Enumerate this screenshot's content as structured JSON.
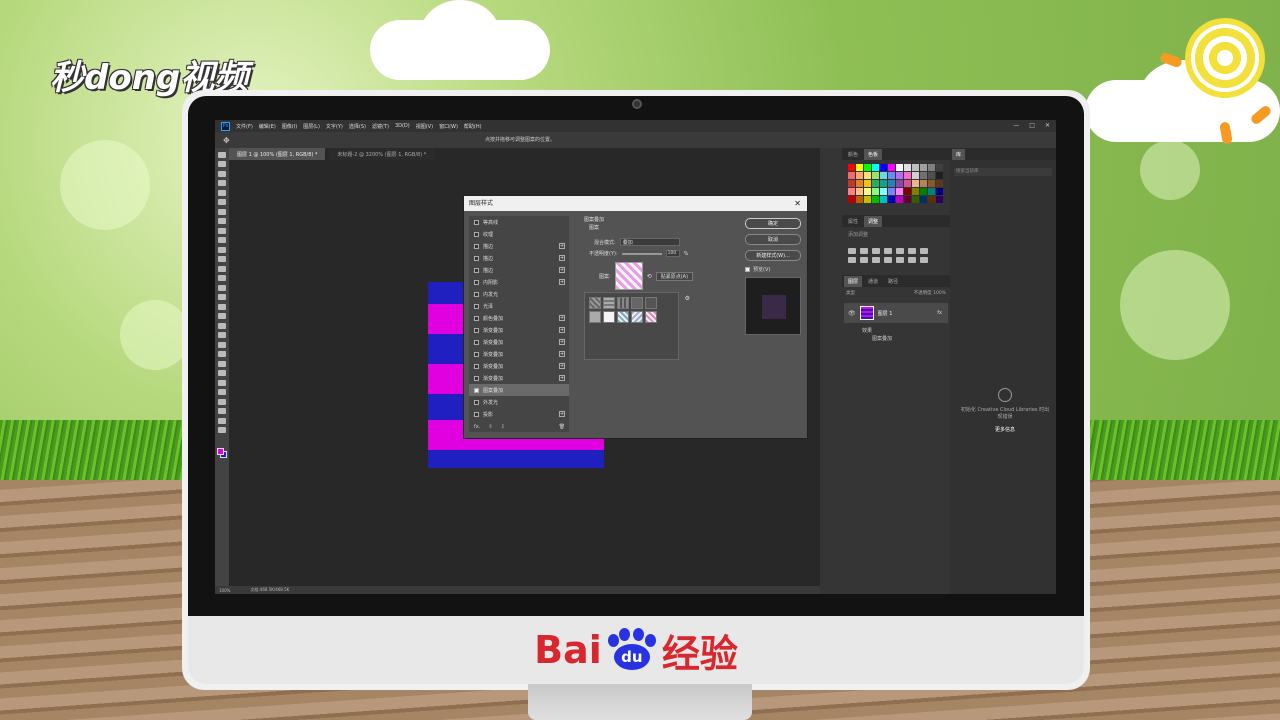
{
  "branding": {
    "top_logo": "秒dong视频",
    "bottom_logo_text_left": "Bai",
    "bottom_logo_paw": "du",
    "bottom_logo_text_right": "经验"
  },
  "app": {
    "logo": "Ps",
    "menu": [
      "文件(F)",
      "编辑(E)",
      "图像(I)",
      "图层(L)",
      "文字(Y)",
      "选择(S)",
      "滤镜(T)",
      "3D(D)",
      "视图(V)",
      "窗口(W)",
      "帮助(H)"
    ],
    "window_controls": [
      "—",
      "□",
      "✕"
    ],
    "options_hint": "点按并拖移可调整图案的位置。",
    "doc_tabs": [
      "图层 1 @ 100% (图层 1, RGB/8) *",
      "未标题-2 @ 3200% (图层 1, RGB/8) *"
    ],
    "status_zoom": "100%",
    "status_doc": "文档:468.5K/468.5K"
  },
  "colors": {
    "magenta": "#e000e0",
    "blue": "#2020c0",
    "ui_dark": "#282828",
    "ui_panel": "#353535"
  },
  "dialog": {
    "title": "图层样式",
    "close": "✕",
    "styles": [
      {
        "label": "等高线",
        "checked": false,
        "plus": false
      },
      {
        "label": "纹理",
        "checked": false,
        "plus": false
      },
      {
        "label": "描边",
        "checked": false,
        "plus": true
      },
      {
        "label": "描边",
        "checked": false,
        "plus": true
      },
      {
        "label": "描边",
        "checked": false,
        "plus": true
      },
      {
        "label": "内阴影",
        "checked": false,
        "plus": true
      },
      {
        "label": "内发光",
        "checked": false,
        "plus": false
      },
      {
        "label": "光泽",
        "checked": false,
        "plus": false
      },
      {
        "label": "颜色叠加",
        "checked": false,
        "plus": true
      },
      {
        "label": "渐变叠加",
        "checked": false,
        "plus": true
      },
      {
        "label": "渐变叠加",
        "checked": false,
        "plus": true
      },
      {
        "label": "渐变叠加",
        "checked": false,
        "plus": true
      },
      {
        "label": "渐变叠加",
        "checked": false,
        "plus": true
      },
      {
        "label": "渐变叠加",
        "checked": false,
        "plus": true
      },
      {
        "label": "图案叠加",
        "checked": true,
        "plus": false,
        "active": true
      },
      {
        "label": "外发光",
        "checked": false,
        "plus": false
      },
      {
        "label": "投影",
        "checked": false,
        "plus": true
      }
    ],
    "list_footer": [
      "fx.",
      "⇧",
      "⇩",
      "🗑"
    ],
    "section_title": "图案叠加",
    "subsection": "图案",
    "blend_label": "混合模式:",
    "blend_value": "叠加",
    "opacity_label": "不透明度(Y):",
    "opacity_value": "100",
    "opacity_unit": "%",
    "pattern_label": "图案:",
    "snap_button": "贴紧原点(A)",
    "buttons": {
      "ok": "确定",
      "cancel": "取消",
      "new_style": "新建样式(W)...",
      "preview_label": "预览(V)"
    }
  },
  "panels": {
    "swatch_tabs": [
      "颜色",
      "色板"
    ],
    "props_tabs": [
      "属性",
      "调整"
    ],
    "props_hint": "添加调整",
    "layer_tabs": [
      "图层",
      "通道",
      "路径"
    ],
    "layer_search": "类型",
    "layer_opacity_label": "不透明度",
    "layer_opacity": "100%",
    "layer_name": "图层 1",
    "layer_fx": "fx",
    "effects_label": "效果",
    "effect_item": "图案叠加",
    "lib_tab": "库",
    "lib_search": "搜索当前库",
    "lib_message": "初始化 Creative Cloud Libraries 时出现错误",
    "lib_link": "更多信息"
  }
}
